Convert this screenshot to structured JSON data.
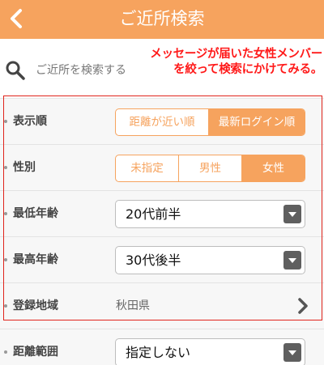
{
  "header": {
    "title": "ご近所検索"
  },
  "search": {
    "placeholder": "ご近所を検索する"
  },
  "annotation": {
    "line1": "メッセージが届いた女性メンバー",
    "line2": "を絞って検索にかけてみる。"
  },
  "rows": {
    "order": {
      "label": "表示順",
      "options": [
        "距離が近い順",
        "最新ログイン順"
      ],
      "selected": "最新ログイン順"
    },
    "gender": {
      "label": "性別",
      "options": [
        "未指定",
        "男性",
        "女性"
      ],
      "selected": "女性"
    },
    "min_age": {
      "label": "最低年齢",
      "value": "20代前半"
    },
    "max_age": {
      "label": "最高年齢",
      "value": "30代後半"
    },
    "region": {
      "label": "登録地域",
      "value": "秋田県"
    },
    "distance": {
      "label": "距離範囲",
      "value": "指定しない"
    }
  },
  "colors": {
    "accent": "#f6a35e",
    "annotation": "#ff1a1a",
    "highlight_box": "#e0241c"
  },
  "icons": {
    "back": "chevron-left-icon",
    "search": "search-icon",
    "region_next": "chevron-right-icon"
  }
}
